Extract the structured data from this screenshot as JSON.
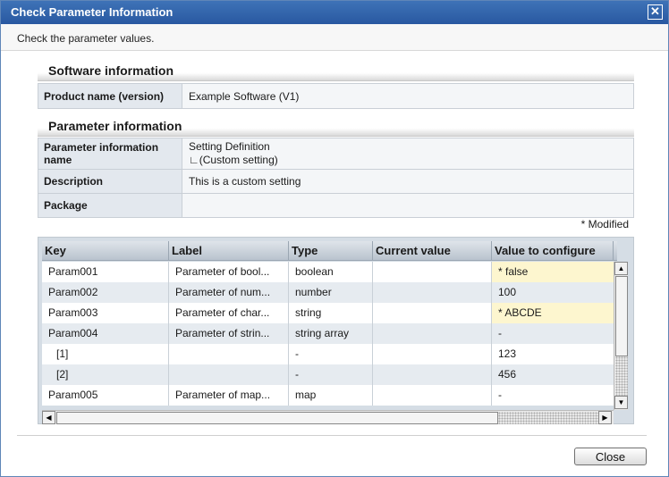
{
  "dialog": {
    "title": "Check Parameter Information",
    "close_glyph": "✕"
  },
  "instruction": "Check the parameter values.",
  "software": {
    "section_title": "Software information",
    "product_label": "Product name (version)",
    "product_value": "Example Software (V1)"
  },
  "parameter": {
    "section_title": "Parameter information",
    "name_label": "Parameter information name",
    "name_value_line1": "Setting Definition",
    "name_value_line2": "∟(Custom setting)",
    "description_label": "Description",
    "description_value": "This is a custom setting",
    "package_label": "Package",
    "package_value": ""
  },
  "modified_note": "* Modified",
  "grid": {
    "columns": [
      "Key",
      "Label",
      "Type",
      "Current value",
      "Value to configure"
    ],
    "rows": [
      {
        "key": "Param001",
        "label": "Parameter of bool...",
        "type": "boolean",
        "current": "",
        "configure": "* false",
        "modified": true
      },
      {
        "key": "Param002",
        "label": "Parameter of num...",
        "type": "number",
        "current": "",
        "configure": "100",
        "modified": false
      },
      {
        "key": "Param003",
        "label": "Parameter of char...",
        "type": "string",
        "current": "",
        "configure": "* ABCDE",
        "modified": true
      },
      {
        "key": "Param004",
        "label": "Parameter of strin...",
        "type": "string array",
        "current": "",
        "configure": "-",
        "modified": false
      },
      {
        "key": "[1]",
        "label": "",
        "type": "-",
        "current": "",
        "configure": "123",
        "modified": false,
        "indent": true
      },
      {
        "key": "[2]",
        "label": "",
        "type": "-",
        "current": "",
        "configure": "456",
        "modified": false,
        "indent": true
      },
      {
        "key": "Param005",
        "label": "Parameter of map...",
        "type": "map",
        "current": "",
        "configure": "-",
        "modified": false
      }
    ]
  },
  "buttons": {
    "close": "Close"
  },
  "colors": {
    "row_white": "#ffffff",
    "row_alt": "#e6ebf0",
    "modified_bg": "#fdf6cf"
  }
}
